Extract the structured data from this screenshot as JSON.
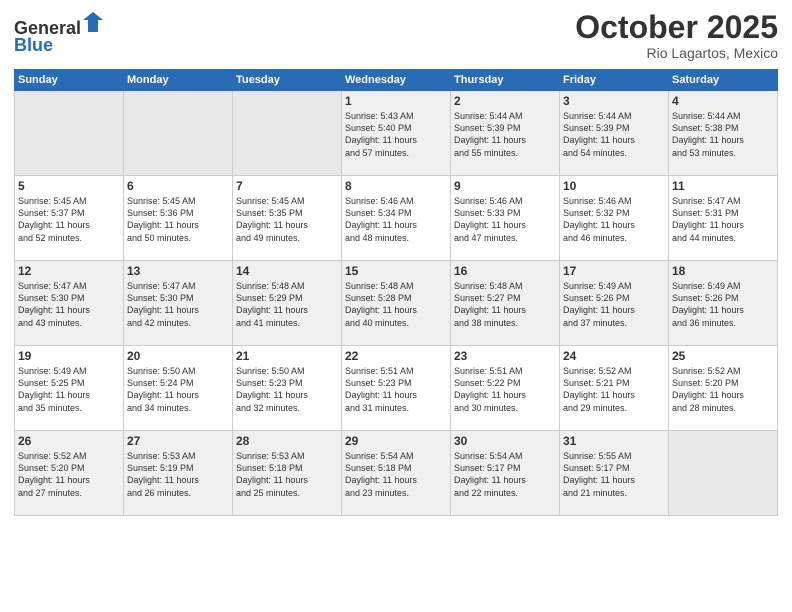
{
  "header": {
    "logo_line1": "General",
    "logo_line2": "Blue",
    "month": "October 2025",
    "location": "Rio Lagartos, Mexico"
  },
  "weekdays": [
    "Sunday",
    "Monday",
    "Tuesday",
    "Wednesday",
    "Thursday",
    "Friday",
    "Saturday"
  ],
  "weeks": [
    [
      {
        "day": "",
        "info": ""
      },
      {
        "day": "",
        "info": ""
      },
      {
        "day": "",
        "info": ""
      },
      {
        "day": "1",
        "info": "Sunrise: 5:43 AM\nSunset: 5:40 PM\nDaylight: 11 hours\nand 57 minutes."
      },
      {
        "day": "2",
        "info": "Sunrise: 5:44 AM\nSunset: 5:39 PM\nDaylight: 11 hours\nand 55 minutes."
      },
      {
        "day": "3",
        "info": "Sunrise: 5:44 AM\nSunset: 5:39 PM\nDaylight: 11 hours\nand 54 minutes."
      },
      {
        "day": "4",
        "info": "Sunrise: 5:44 AM\nSunset: 5:38 PM\nDaylight: 11 hours\nand 53 minutes."
      }
    ],
    [
      {
        "day": "5",
        "info": "Sunrise: 5:45 AM\nSunset: 5:37 PM\nDaylight: 11 hours\nand 52 minutes."
      },
      {
        "day": "6",
        "info": "Sunrise: 5:45 AM\nSunset: 5:36 PM\nDaylight: 11 hours\nand 50 minutes."
      },
      {
        "day": "7",
        "info": "Sunrise: 5:45 AM\nSunset: 5:35 PM\nDaylight: 11 hours\nand 49 minutes."
      },
      {
        "day": "8",
        "info": "Sunrise: 5:46 AM\nSunset: 5:34 PM\nDaylight: 11 hours\nand 48 minutes."
      },
      {
        "day": "9",
        "info": "Sunrise: 5:46 AM\nSunset: 5:33 PM\nDaylight: 11 hours\nand 47 minutes."
      },
      {
        "day": "10",
        "info": "Sunrise: 5:46 AM\nSunset: 5:32 PM\nDaylight: 11 hours\nand 46 minutes."
      },
      {
        "day": "11",
        "info": "Sunrise: 5:47 AM\nSunset: 5:31 PM\nDaylight: 11 hours\nand 44 minutes."
      }
    ],
    [
      {
        "day": "12",
        "info": "Sunrise: 5:47 AM\nSunset: 5:30 PM\nDaylight: 11 hours\nand 43 minutes."
      },
      {
        "day": "13",
        "info": "Sunrise: 5:47 AM\nSunset: 5:30 PM\nDaylight: 11 hours\nand 42 minutes."
      },
      {
        "day": "14",
        "info": "Sunrise: 5:48 AM\nSunset: 5:29 PM\nDaylight: 11 hours\nand 41 minutes."
      },
      {
        "day": "15",
        "info": "Sunrise: 5:48 AM\nSunset: 5:28 PM\nDaylight: 11 hours\nand 40 minutes."
      },
      {
        "day": "16",
        "info": "Sunrise: 5:48 AM\nSunset: 5:27 PM\nDaylight: 11 hours\nand 38 minutes."
      },
      {
        "day": "17",
        "info": "Sunrise: 5:49 AM\nSunset: 5:26 PM\nDaylight: 11 hours\nand 37 minutes."
      },
      {
        "day": "18",
        "info": "Sunrise: 5:49 AM\nSunset: 5:26 PM\nDaylight: 11 hours\nand 36 minutes."
      }
    ],
    [
      {
        "day": "19",
        "info": "Sunrise: 5:49 AM\nSunset: 5:25 PM\nDaylight: 11 hours\nand 35 minutes."
      },
      {
        "day": "20",
        "info": "Sunrise: 5:50 AM\nSunset: 5:24 PM\nDaylight: 11 hours\nand 34 minutes."
      },
      {
        "day": "21",
        "info": "Sunrise: 5:50 AM\nSunset: 5:23 PM\nDaylight: 11 hours\nand 32 minutes."
      },
      {
        "day": "22",
        "info": "Sunrise: 5:51 AM\nSunset: 5:23 PM\nDaylight: 11 hours\nand 31 minutes."
      },
      {
        "day": "23",
        "info": "Sunrise: 5:51 AM\nSunset: 5:22 PM\nDaylight: 11 hours\nand 30 minutes."
      },
      {
        "day": "24",
        "info": "Sunrise: 5:52 AM\nSunset: 5:21 PM\nDaylight: 11 hours\nand 29 minutes."
      },
      {
        "day": "25",
        "info": "Sunrise: 5:52 AM\nSunset: 5:20 PM\nDaylight: 11 hours\nand 28 minutes."
      }
    ],
    [
      {
        "day": "26",
        "info": "Sunrise: 5:52 AM\nSunset: 5:20 PM\nDaylight: 11 hours\nand 27 minutes."
      },
      {
        "day": "27",
        "info": "Sunrise: 5:53 AM\nSunset: 5:19 PM\nDaylight: 11 hours\nand 26 minutes."
      },
      {
        "day": "28",
        "info": "Sunrise: 5:53 AM\nSunset: 5:18 PM\nDaylight: 11 hours\nand 25 minutes."
      },
      {
        "day": "29",
        "info": "Sunrise: 5:54 AM\nSunset: 5:18 PM\nDaylight: 11 hours\nand 23 minutes."
      },
      {
        "day": "30",
        "info": "Sunrise: 5:54 AM\nSunset: 5:17 PM\nDaylight: 11 hours\nand 22 minutes."
      },
      {
        "day": "31",
        "info": "Sunrise: 5:55 AM\nSunset: 5:17 PM\nDaylight: 11 hours\nand 21 minutes."
      },
      {
        "day": "",
        "info": ""
      }
    ]
  ]
}
